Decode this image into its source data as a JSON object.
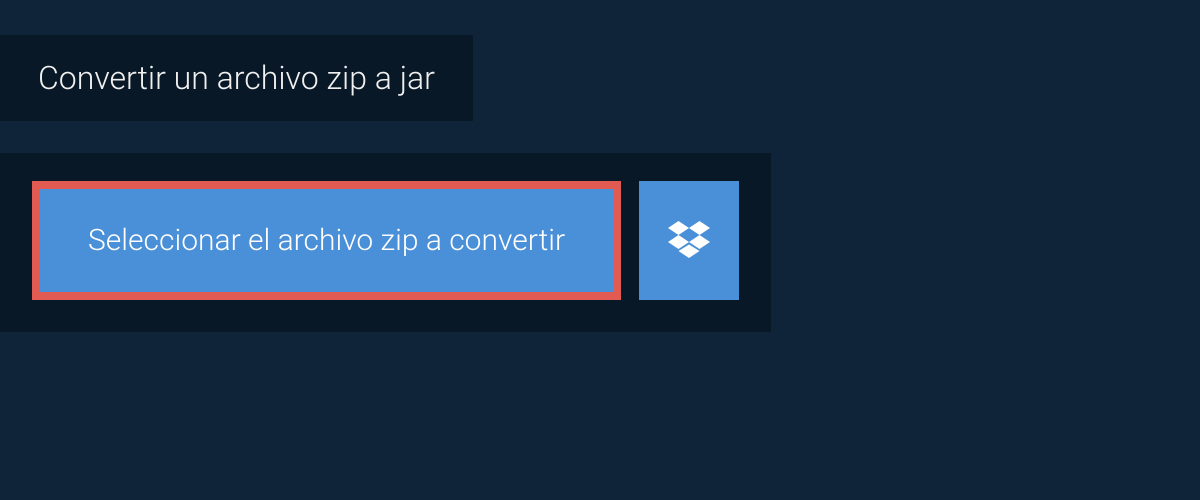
{
  "header": {
    "title": "Convertir un archivo zip a jar"
  },
  "buttons": {
    "select_file_label": "Seleccionar el archivo zip a convertir"
  },
  "colors": {
    "background": "#0f2438",
    "panel": "#081826",
    "button": "#4a90d9",
    "highlight_border": "#e25b52",
    "text": "#ffffff"
  }
}
